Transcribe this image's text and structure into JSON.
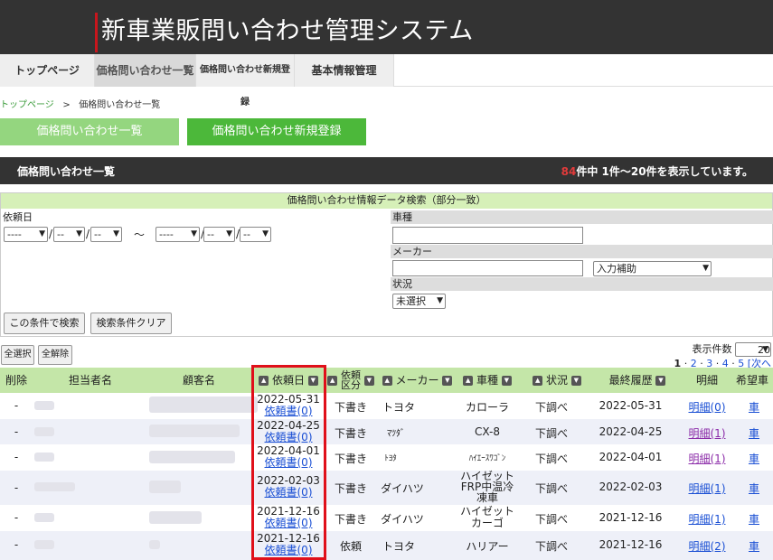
{
  "header": {
    "title": "新車業販問い合わせ管理システム"
  },
  "nav": {
    "tabs": [
      "トップページ",
      "価格問い合わせ一覧",
      "価格問い合わせ新規登録",
      "基本情報管理"
    ]
  },
  "breadcrumb": {
    "home": "トップページ",
    "sep": ">",
    "current": "価格問い合わせ一覧"
  },
  "actions": {
    "list_button": "価格問い合わせ一覧",
    "new_button": "価格問い合わせ新規登録"
  },
  "listbar": {
    "title": "価格問い合わせ一覧",
    "count": "84",
    "summary": "件中 1件～20件を表示しています。"
  },
  "search": {
    "heading": "価格問い合わせ情報データ検索（部分一致）",
    "request_date_label": "依頼日",
    "date_sel_year": "----",
    "date_sel_md": "--",
    "slash": "/",
    "tilde": "～",
    "car_label": "車種",
    "maker_label": "メーカー",
    "maker_assist": "入力補助",
    "status_label": "状況",
    "status_value": "未選択",
    "search_button": "この条件で検索",
    "clear_button": "検索条件クリア"
  },
  "bulk": {
    "select_all": "全選択",
    "deselect_all": "全解除"
  },
  "pager": {
    "per_page_label": "表示件数",
    "per_page": "20",
    "current": "1",
    "pages": [
      "2",
      "3",
      "4",
      "5"
    ],
    "next": "[次へ"
  },
  "table": {
    "headers": {
      "delete": "削除",
      "staff": "担当者名",
      "customer": "顧客名",
      "date": "依頼日",
      "type": "依頼区分",
      "maker": "メーカー",
      "car": "車種",
      "status": "状況",
      "history": "最終履歴",
      "detail": "明細",
      "wish": "希望車"
    },
    "rows": [
      {
        "del": "-",
        "date": "2022-05-31",
        "req": "依頼書(0)",
        "type": "下書き",
        "maker": "トヨタ",
        "car": "カローラ",
        "status": "下調べ",
        "history": "2022-05-31",
        "detail": "明細(0)",
        "wish": "車"
      },
      {
        "del": "-",
        "date": "2022-04-25",
        "req": "依頼書(0)",
        "type": "下書き",
        "maker": "ﾏﾂﾀﾞ",
        "car": "CX-8",
        "status": "下調べ",
        "history": "2022-04-25",
        "detail": "明細(1)",
        "wish": "車"
      },
      {
        "del": "-",
        "date": "2022-04-01",
        "req": "依頼書(0)",
        "type": "下書き",
        "maker": "ﾄﾖﾀ",
        "car": "ﾊｲｴｰｽﾜｺﾞﾝ",
        "status": "下調べ",
        "history": "2022-04-01",
        "detail": "明細(1)",
        "wish": "車"
      },
      {
        "del": "-",
        "date": "2022-02-03",
        "req": "依頼書(0)",
        "type": "下書き",
        "maker": "ダイハツ",
        "car_l1": "ハイゼット",
        "car_l2": "FRP中温冷",
        "car_l3": "凍車",
        "status": "下調べ",
        "history": "2022-02-03",
        "detail": "明細(1)",
        "wish": "車"
      },
      {
        "del": "-",
        "date": "2021-12-16",
        "req": "依頼書(0)",
        "type": "下書き",
        "maker": "ダイハツ",
        "car_l1": "ハイゼット",
        "car_l2": "カーゴ",
        "status": "下調べ",
        "history": "2021-12-16",
        "detail": "明細(1)",
        "wish": "車"
      },
      {
        "del": "-",
        "date": "2021-12-16",
        "req": "依頼書(0)",
        "type": "依頼",
        "maker": "トヨタ",
        "car": "ハリアー",
        "status": "下調べ",
        "history": "2021-12-16",
        "detail": "明細(2)",
        "wish": "車"
      }
    ]
  }
}
